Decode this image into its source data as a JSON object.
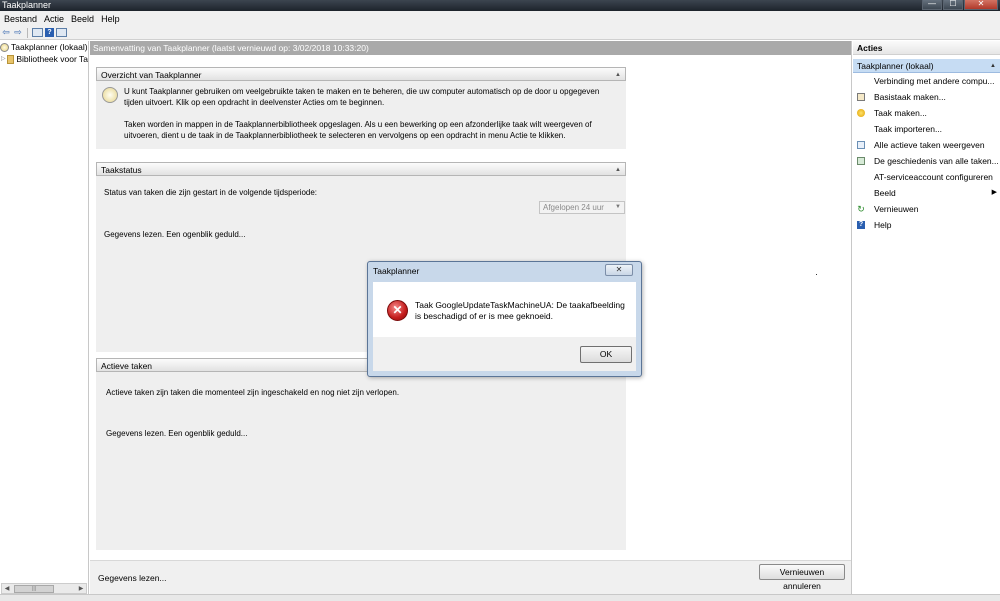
{
  "window": {
    "title": "Taakplanner",
    "controls": {
      "minimize": "—",
      "maximize": "☐",
      "close": "✕"
    }
  },
  "menubar": {
    "items": [
      "Bestand",
      "Actie",
      "Beeld",
      "Help"
    ]
  },
  "toolbar": {
    "back": "⇦",
    "forward": "⇨",
    "help": "?"
  },
  "tree": {
    "items": [
      {
        "label": "Taakplanner (lokaal)",
        "icon": "clock-icon"
      },
      {
        "label": "Bibliotheek voor Ta",
        "icon": "folder-icon"
      }
    ],
    "scroll_thumb": "|||"
  },
  "center": {
    "header": "Samenvatting van Taakplanner (laatst vernieuwd op: 3/02/2018 10:33:20)",
    "overview": {
      "title": "Overzicht van Taakplanner",
      "para1": "U kunt Taakplanner gebruiken om veelgebruikte taken te maken en te beheren, die uw computer automatisch op de door u opgegeven tijden uitvoert. Klik op een opdracht in deelvenster Acties om te beginnen.",
      "para2": "Taken worden in mappen in de Taakplannerbibliotheek opgeslagen. Als u een bewerking op een afzonderlijke taak wilt weergeven of uitvoeren, dient u de taak in de Taakplannerbibliotheek te selecteren en vervolgens op een opdracht in menu Actie te klikken."
    },
    "status": {
      "title": "Taakstatus",
      "label": "Status van taken die zijn gestart in de volgende tijdsperiode:",
      "period": "Afgelopen 24 uur",
      "loading": "Gegevens lezen. Een ogenblik geduld..."
    },
    "active": {
      "title": "Actieve taken",
      "description": "Actieve taken zijn taken die momenteel zijn ingeschakeld en nog niet zijn verlopen.",
      "loading": "Gegevens lezen. Een ogenblik geduld..."
    },
    "footer": {
      "status": "Gegevens lezen...",
      "cancel_refresh": "Vernieuwen annuleren"
    }
  },
  "actions": {
    "header": "Acties",
    "section": "Taakplanner (lokaal)",
    "items": [
      {
        "label": "Verbinding met andere compu...",
        "icon": "blank"
      },
      {
        "label": "Basistaak maken...",
        "icon": "calendar-icon"
      },
      {
        "label": "Taak maken...",
        "icon": "sun-icon"
      },
      {
        "label": "Taak importeren...",
        "icon": "blank"
      },
      {
        "label": "Alle actieve taken weergeven",
        "icon": "list-icon"
      },
      {
        "label": "De geschiedenis van alle taken...",
        "icon": "history-icon"
      },
      {
        "label": "AT-serviceaccount configureren",
        "icon": "blank"
      },
      {
        "label": "Beeld",
        "icon": "blank",
        "submenu": true
      },
      {
        "label": "Vernieuwen",
        "icon": "refresh-icon"
      },
      {
        "label": "Help",
        "icon": "help-icon"
      }
    ]
  },
  "dialog": {
    "title": "Taakplanner",
    "message": "Taak GoogleUpdateTaskMachineUA: De taakafbeelding is beschadigd of er is mee geknoeid.",
    "ok": "OK",
    "close": "✕"
  }
}
